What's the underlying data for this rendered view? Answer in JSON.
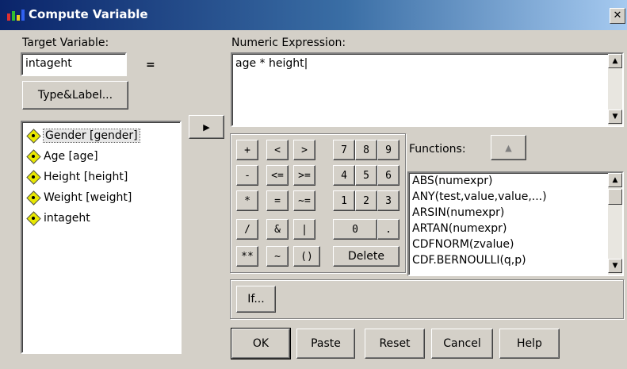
{
  "window": {
    "title": "Compute Variable",
    "close_symbol": "✕"
  },
  "target": {
    "label": "Target Variable:",
    "value": "intageht",
    "equals": "="
  },
  "type_label_button": "Type&Label...",
  "variables": [
    {
      "label": "Gender [gender]"
    },
    {
      "label": "Age [age]"
    },
    {
      "label": "Height [height]"
    },
    {
      "label": "Weight [weight]"
    },
    {
      "label": "intageht"
    }
  ],
  "move_button_symbol": "▶",
  "expression": {
    "label": "Numeric Expression:",
    "value": "age * height|"
  },
  "keypad": {
    "row1": [
      "+",
      "<",
      ">",
      "7",
      "8",
      "9"
    ],
    "row2": [
      "-",
      "<=",
      ">=",
      "4",
      "5",
      "6"
    ],
    "row3": [
      "*",
      "=",
      "~=",
      "1",
      "2",
      "3"
    ],
    "row4": [
      "/",
      "&",
      "|",
      "0",
      "."
    ],
    "row5": [
      "**",
      "~",
      "()"
    ],
    "delete": "Delete"
  },
  "functions": {
    "label": "Functions:",
    "up_symbol": "▲",
    "items": [
      "ABS(numexpr)",
      "ANY(test,value,value,...)",
      "ARSIN(numexpr)",
      "ARTAN(numexpr)",
      "CDFNORM(zvalue)",
      "CDF.BERNOULLI(q,p)"
    ]
  },
  "if_button": "If...",
  "bottom_buttons": {
    "ok": "OK",
    "paste": "Paste",
    "reset": "Reset",
    "cancel": "Cancel",
    "help": "Help"
  }
}
